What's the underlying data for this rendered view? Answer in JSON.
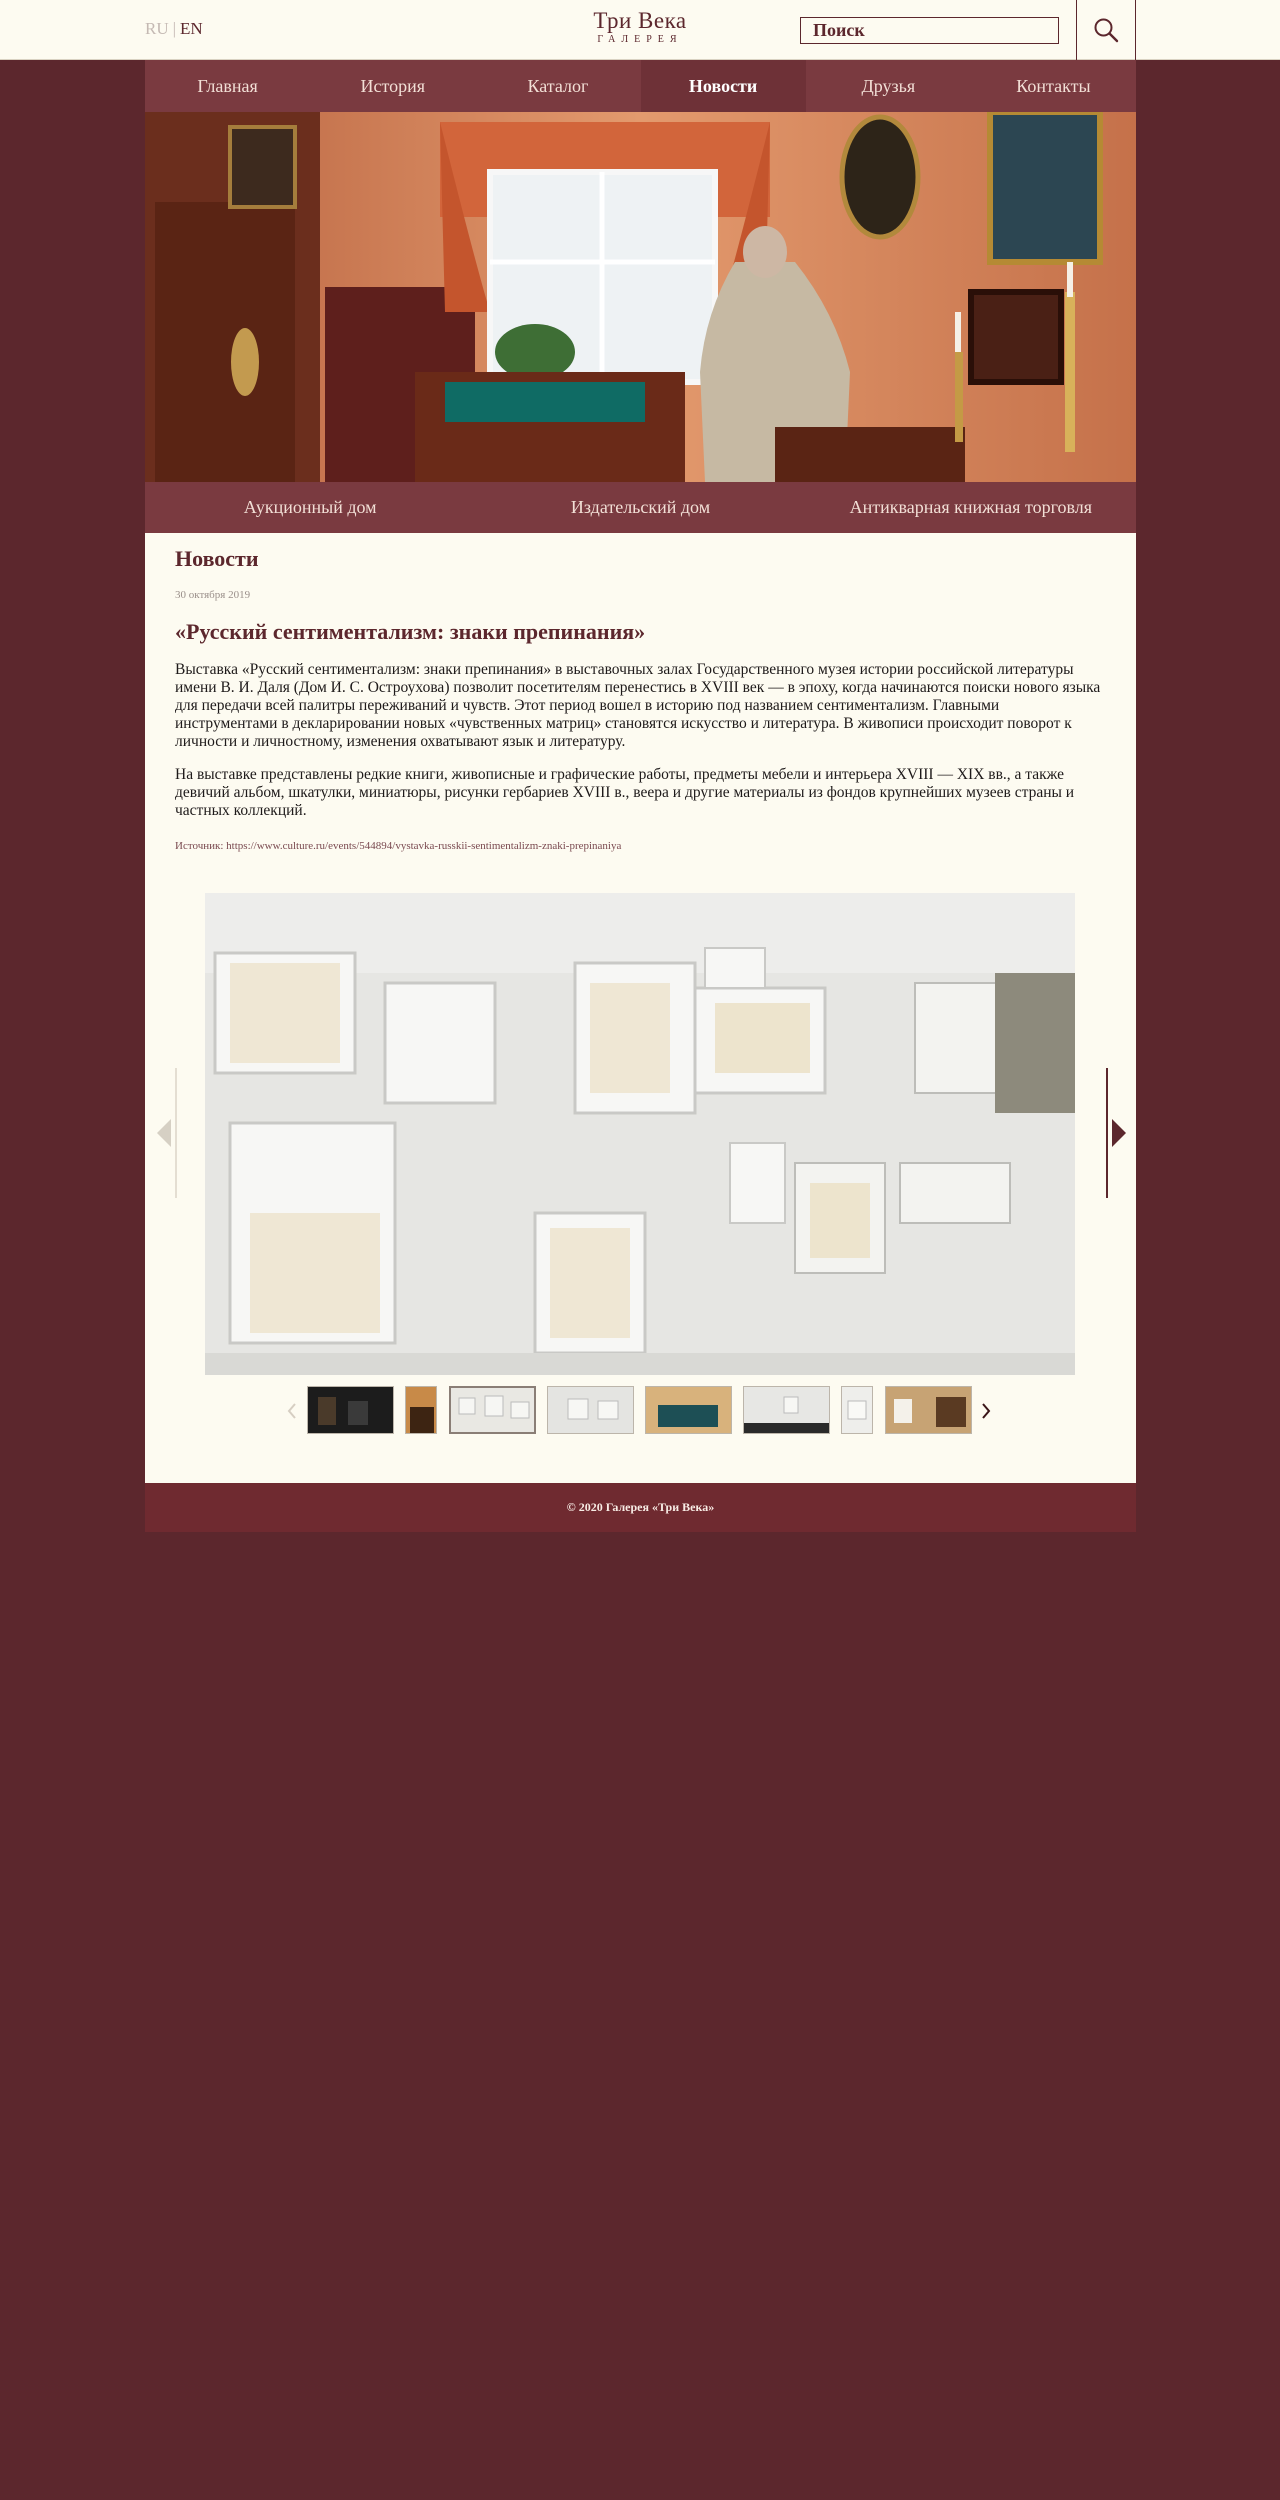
{
  "header": {
    "lang_ru": "RU",
    "lang_sep": "|",
    "lang_en": "EN",
    "logo_line1": "Три Века",
    "logo_line2": "ГАЛЕРЕЯ",
    "search_placeholder": "Поиск",
    "search_icon": "search-icon"
  },
  "nav": {
    "items": [
      {
        "label": "Главная"
      },
      {
        "label": "История"
      },
      {
        "label": "Каталог"
      },
      {
        "label": "Новости",
        "active": true
      },
      {
        "label": "Друзья"
      },
      {
        "label": "Контакты"
      }
    ]
  },
  "banner": {
    "slides": 5,
    "active_slide": 1
  },
  "subnav": {
    "items": [
      {
        "label": "Аукционный дом"
      },
      {
        "label": "Издательский дом"
      },
      {
        "label": "Антикварная книжная торговля"
      }
    ]
  },
  "article": {
    "section_title": "Новости",
    "date": "30 октября 2019",
    "title": "«Русский сентиментализм: знаки препинания»",
    "paragraph1": "Выставка «Русский сентиментализм: знаки препинания» в выставочных залах Государственного музея истории российской литературы имени В. И. Даля (Дом И. С. Остроухова) позволит посетителям перенестись в XVIII век — в эпоху, когда начинаются поиски нового языка для передачи всей палитры переживаний и чувств. Этот период вошел в историю под названием сентиментализм. Главными инструментами в декларировании новых «чувственных матриц» становятся искусство и литература. В живописи происходит поворот к личности и личностному, изменения охватывают язык и литературу.",
    "paragraph2": "На выставке представлены редкие книги, живописные и графические работы, предметы мебели и интерьера XVIII — XIX вв., а также девичий альбом, шкатулки, миниатюры, рисунки гербариев XVIII в., веера и другие материалы из фондов крупнейших музеев страны и частных коллекций.",
    "source_label": "Источник: ",
    "source_url": "https://www.culture.ru/events/544894/vystavka-russkii-sentimentalizm-znaki-prepinaniya"
  },
  "gallery": {
    "thumbnail_count": 8,
    "active_thumbnail": 3
  },
  "footer": {
    "copyright": "© 2020 Галерея «Три Века»"
  },
  "colors": {
    "brand": "#5c272d",
    "nav_bg": "#7a3a40",
    "paper": "#fdfbf1",
    "footer_bg": "#6f2a30"
  }
}
